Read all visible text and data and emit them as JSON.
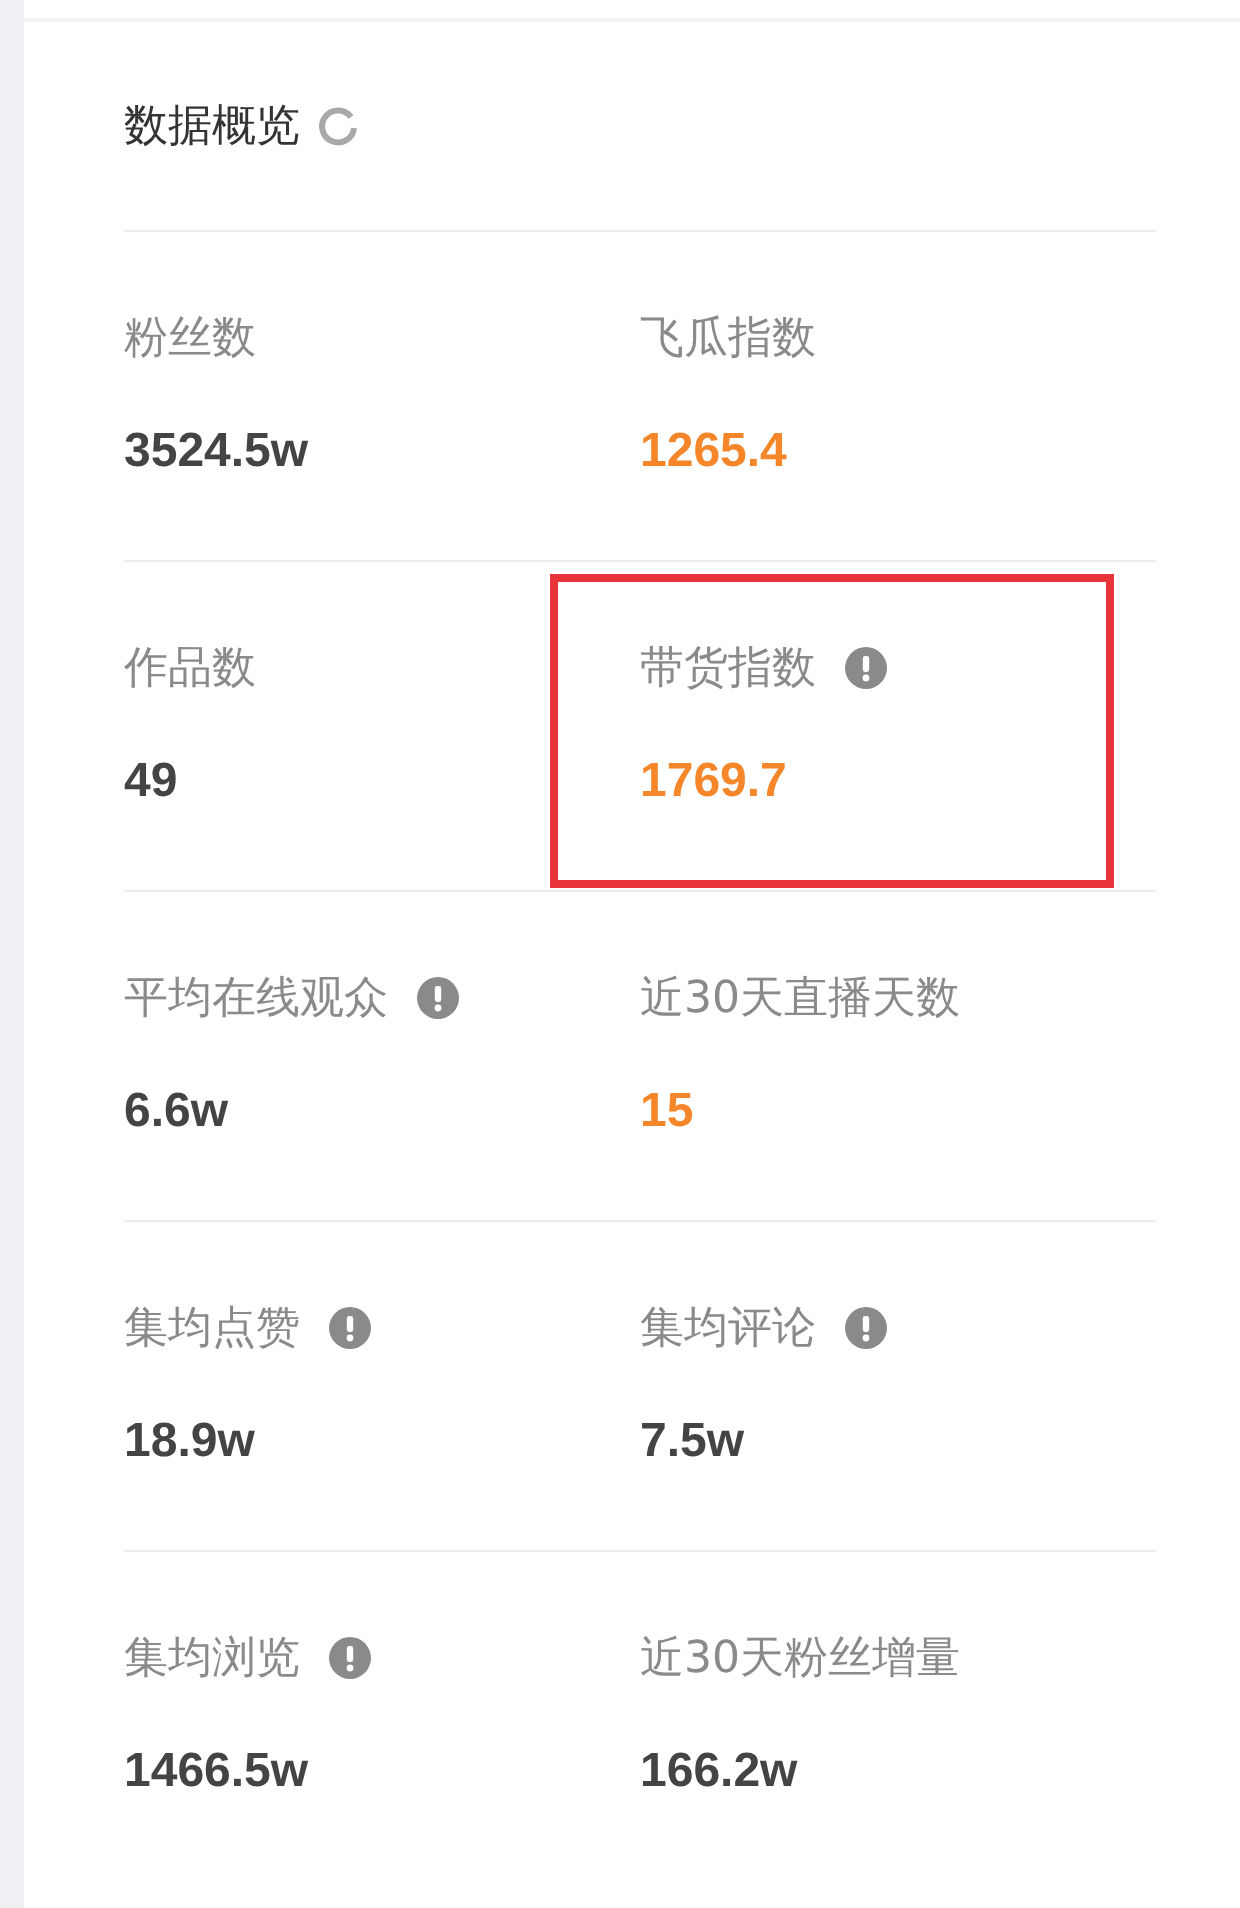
{
  "panel": {
    "title": "数据概览"
  },
  "rows": [
    {
      "cells": [
        {
          "label": "粉丝数",
          "info": false,
          "value": "3524.5w",
          "emphasis": false,
          "highlighted": false
        },
        {
          "label": "飞瓜指数",
          "info": false,
          "value": "1265.4",
          "emphasis": true,
          "highlighted": false
        }
      ]
    },
    {
      "cells": [
        {
          "label": "作品数",
          "info": false,
          "value": "49",
          "emphasis": false,
          "highlighted": false
        },
        {
          "label": "带货指数",
          "info": true,
          "value": "1769.7",
          "emphasis": true,
          "highlighted": true
        }
      ]
    },
    {
      "cells": [
        {
          "label": "平均在线观众",
          "info": true,
          "value": "6.6w",
          "emphasis": false,
          "highlighted": false
        },
        {
          "label": "近30天直播天数",
          "info": false,
          "value": "15",
          "emphasis": true,
          "highlighted": false
        }
      ]
    },
    {
      "cells": [
        {
          "label": "集均点赞",
          "info": true,
          "value": "18.9w",
          "emphasis": false,
          "highlighted": false
        },
        {
          "label": "集均评论",
          "info": true,
          "value": "7.5w",
          "emphasis": false,
          "highlighted": false
        }
      ]
    },
    {
      "cells": [
        {
          "label": "集均浏览",
          "info": true,
          "value": "1466.5w",
          "emphasis": false,
          "highlighted": false
        },
        {
          "label": "近30天粉丝增量",
          "info": false,
          "value": "166.2w",
          "emphasis": false,
          "highlighted": false
        }
      ]
    }
  ]
}
